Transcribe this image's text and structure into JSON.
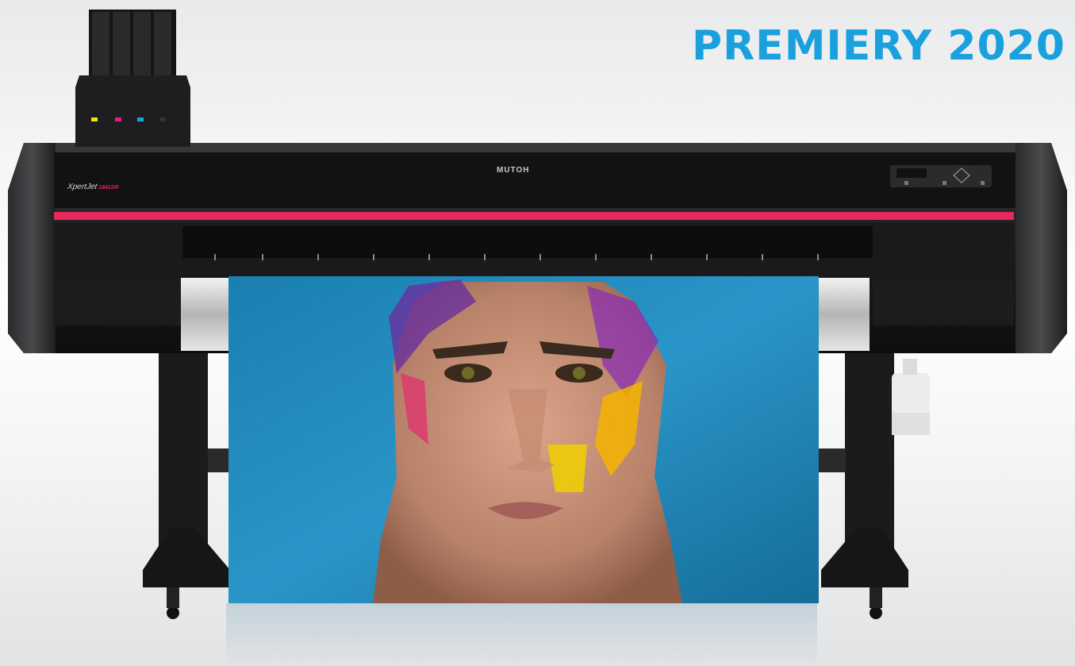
{
  "headline": "PREMIERY 2020",
  "printer": {
    "brand_label": "MUTOH",
    "model_label": "XpertJet",
    "model_number": "1641SR"
  },
  "colors": {
    "headline": "#1aa0dc",
    "accent_stripe": "#e8285a",
    "body": "#1c1c1e",
    "print_background": "#1f86b8"
  },
  "ink_cartridges": [
    "yellow",
    "magenta",
    "cyan",
    "black"
  ]
}
